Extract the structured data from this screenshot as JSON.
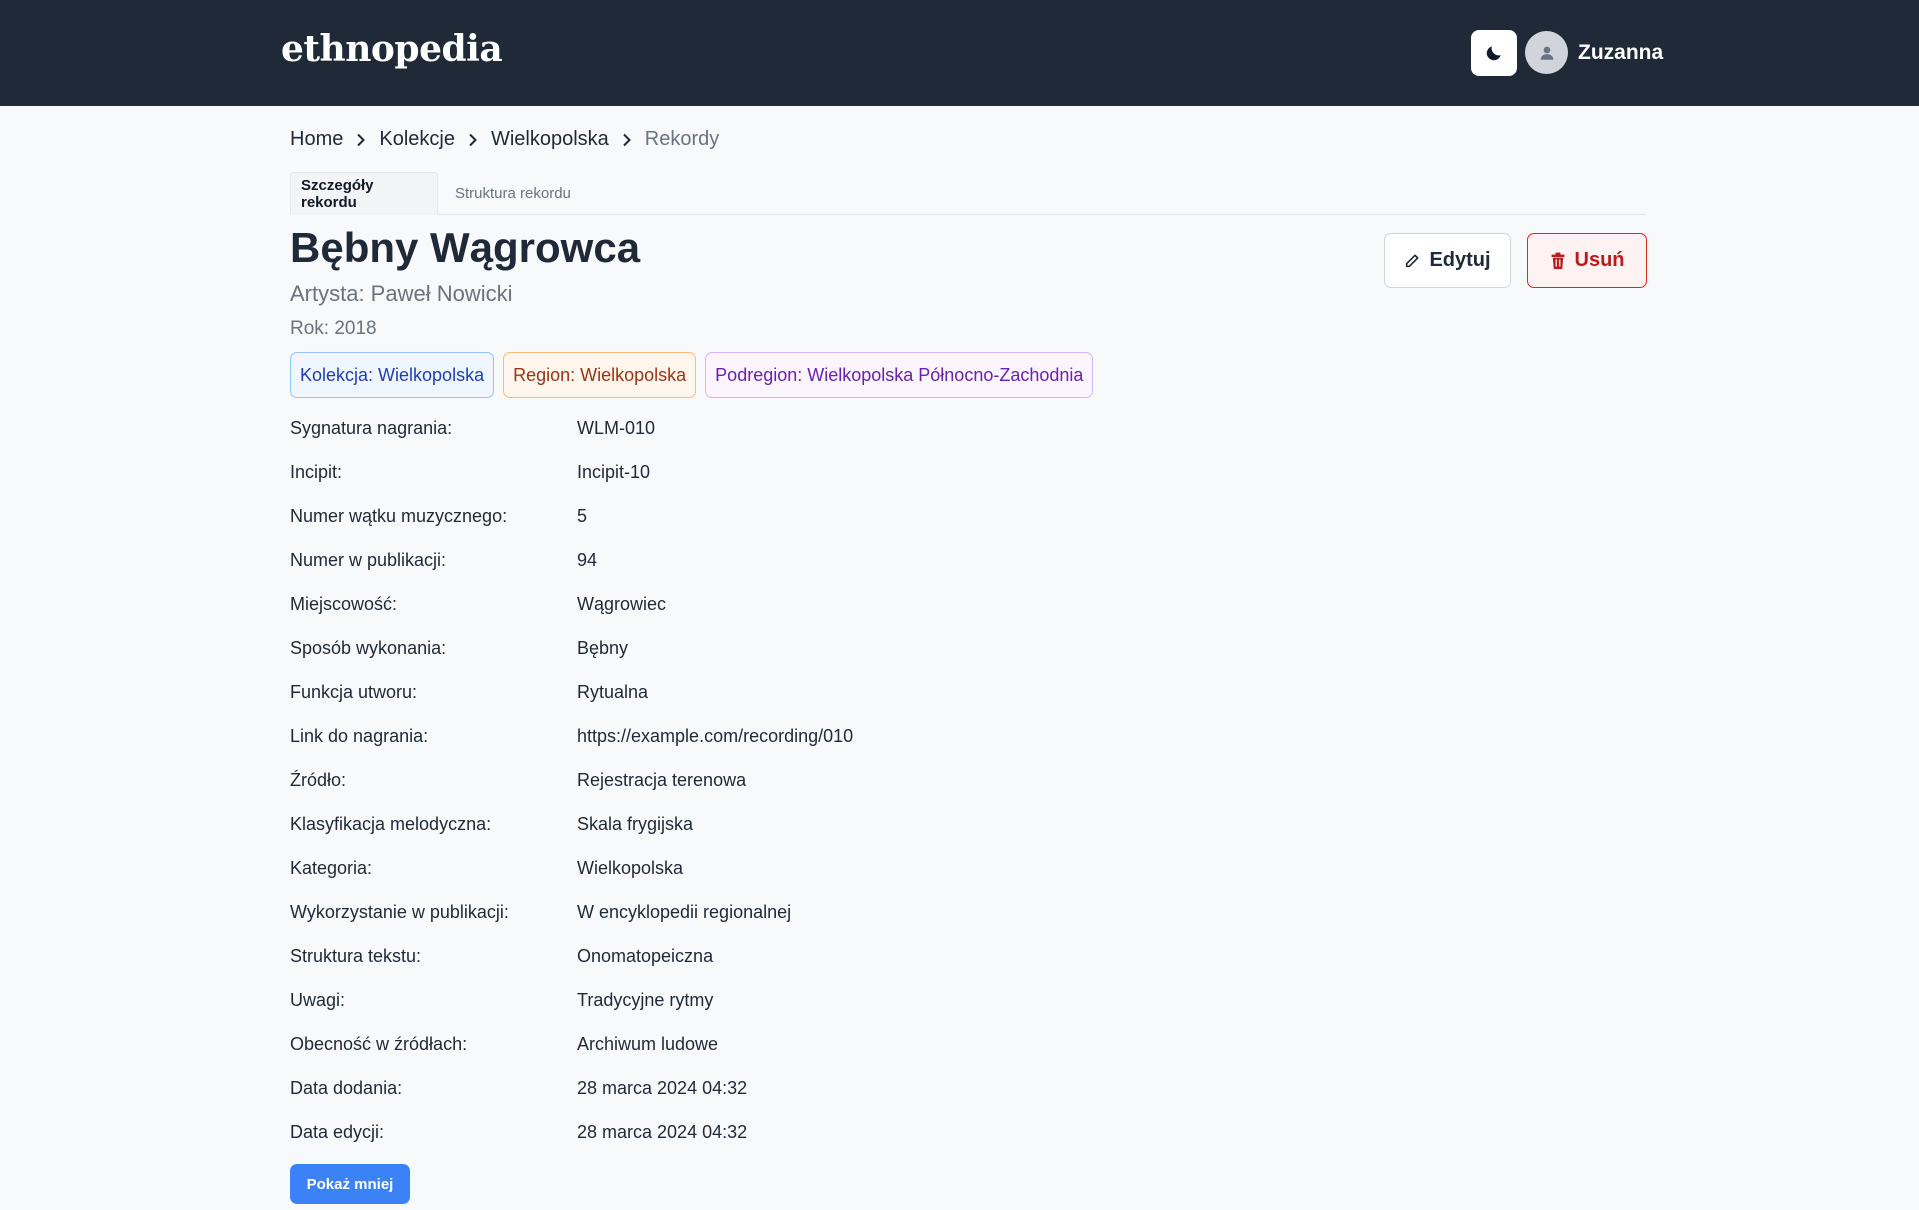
{
  "header": {
    "logo": "ethnopedia",
    "theme_toggle_icon": "moon-icon",
    "user_icon": "user-icon",
    "username": "Zuzanna"
  },
  "breadcrumb": [
    {
      "label": "Home"
    },
    {
      "label": "Kolekcje"
    },
    {
      "label": "Wielkopolska"
    },
    {
      "label": "Rekordy"
    }
  ],
  "tabs": [
    {
      "label": "Szczegóły rekordu",
      "active": true
    },
    {
      "label": "Struktura rekordu",
      "active": false
    }
  ],
  "record": {
    "title": "Bębny Wągrowca",
    "artist": "Artysta: Paweł Nowicki",
    "year": "Rok: 2018"
  },
  "actions": {
    "edit_label": "Edytuj",
    "edit_icon": "pencil-icon",
    "delete_label": "Usuń",
    "delete_icon": "trash-icon"
  },
  "badges": [
    {
      "label": "Kolekcja: Wielkopolska",
      "color": "#1e40af"
    },
    {
      "label": "Region: Wielkopolska",
      "color": "#9a3412"
    },
    {
      "label": "Podregion: Wielkopolska Północno-Zachodnia",
      "color": "#6b21a8"
    }
  ],
  "fields": [
    {
      "label": "Sygnatura nagrania:",
      "value": "WLM-010"
    },
    {
      "label": "Incipit:",
      "value": "Incipit-10"
    },
    {
      "label": "Numer wątku muzycznego:",
      "value": "5"
    },
    {
      "label": "Numer w publikacji:",
      "value": "94"
    },
    {
      "label": "Miejscowość:",
      "value": "Wągrowiec"
    },
    {
      "label": "Sposób wykonania:",
      "value": "Bębny"
    },
    {
      "label": "Funkcja utworu:",
      "value": "Rytualna"
    },
    {
      "label": "Link do nagrania:",
      "value": "https://example.com/recording/010"
    },
    {
      "label": "Źródło:",
      "value": "Rejestracja terenowa"
    },
    {
      "label": "Klasyfikacja melodyczna:",
      "value": "Skala frygijska"
    },
    {
      "label": "Kategoria:",
      "value": "Wielkopolska"
    },
    {
      "label": "Wykorzystanie w publikacji:",
      "value": "W encyklopedii regionalnej"
    },
    {
      "label": "Struktura tekstu:",
      "value": "Onomatopeiczna"
    },
    {
      "label": "Uwagi:",
      "value": "Tradycyjne rytmy"
    },
    {
      "label": "Obecność w źródłach:",
      "value": "Archiwum ludowe"
    },
    {
      "label": "Data dodania:",
      "value": "28 marca 2024 04:32"
    },
    {
      "label": "Data edycji:",
      "value": "28 marca 2024 04:32"
    }
  ],
  "show_less_label": "Pokaż mniej",
  "colors": {
    "header_bg": "#1f2937",
    "primary": "#3b82f6",
    "danger": "#dc2626"
  }
}
